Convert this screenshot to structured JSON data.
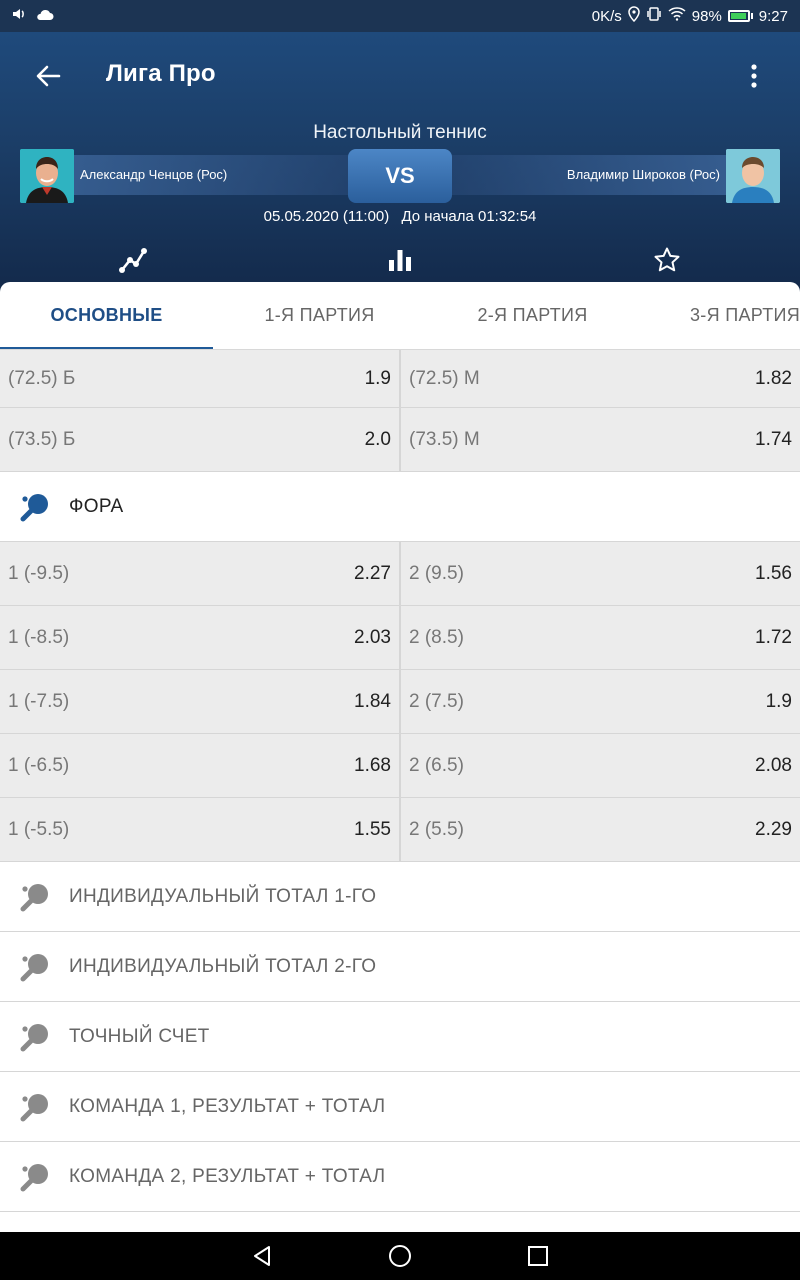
{
  "status_bar": {
    "speed": "0K/s",
    "battery": "98%",
    "time": "9:27",
    "battery_level": 0.98
  },
  "header": {
    "title": "Лига Про",
    "sport": "Настольный теннис",
    "team1": "Александр Ченцов (Рос)",
    "team2": "Владимир Широков (Рос)",
    "vs": "VS",
    "date": "05.05.2020 (11:00)",
    "countdown": "До начала 01:32:54"
  },
  "tabs": [
    {
      "label": "ОСНОВНЫЕ",
      "active": true
    },
    {
      "label": "1-Я ПАРТИЯ",
      "active": false
    },
    {
      "label": "2-Я ПАРТИЯ",
      "active": false
    },
    {
      "label": "3-Я ПАРТИЯ",
      "active": false
    }
  ],
  "totals": [
    {
      "left_label": "(72.5) Б",
      "left_value": "1.9",
      "right_label": "(72.5) М",
      "right_value": "1.82"
    },
    {
      "left_label": "(73.5) Б",
      "left_value": "2.0",
      "right_label": "(73.5) М",
      "right_value": "1.74"
    }
  ],
  "handicap_section": "ФОРА",
  "handicap": [
    {
      "left_label": "1 (-9.5)",
      "left_value": "2.27",
      "right_label": "2 (9.5)",
      "right_value": "1.56"
    },
    {
      "left_label": "1 (-8.5)",
      "left_value": "2.03",
      "right_label": "2 (8.5)",
      "right_value": "1.72"
    },
    {
      "left_label": "1 (-7.5)",
      "left_value": "1.84",
      "right_label": "2 (7.5)",
      "right_value": "1.9"
    },
    {
      "left_label": "1 (-6.5)",
      "left_value": "1.68",
      "right_label": "2 (6.5)",
      "right_value": "2.08"
    },
    {
      "left_label": "1 (-5.5)",
      "left_value": "1.55",
      "right_label": "2 (5.5)",
      "right_value": "2.29"
    }
  ],
  "sections": [
    "ИНДИВИДУАЛЬНЫЙ ТОТАЛ 1-ГО",
    "ИНДИВИДУАЛЬНЫЙ ТОТАЛ 2-ГО",
    "ТОЧНЫЙ СЧЕТ",
    "КОМАНДА 1, РЕЗУЛЬТАТ + ТОТАЛ",
    "КОМАНДА 2, РЕЗУЛЬТАТ + ТОТАЛ"
  ],
  "colors": {
    "header_bg": "#1b3d66",
    "accent": "#1f5a98",
    "active_icon": "#1f5a98",
    "inactive_icon": "#8a8a8a"
  }
}
